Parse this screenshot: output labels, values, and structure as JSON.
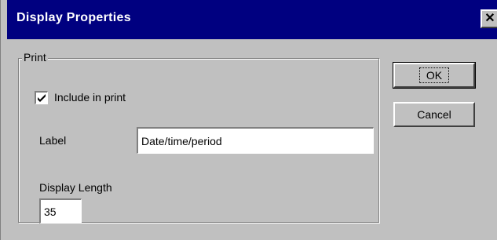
{
  "window": {
    "title": "Display Properties",
    "close_glyph": "✕"
  },
  "print_group": {
    "label": "Print",
    "include_in_print": {
      "label": "Include in print",
      "checked": true
    },
    "label_field": {
      "caption": "Label",
      "value": "Date/time/period"
    },
    "display_length": {
      "caption": "Display Length",
      "value": "35"
    }
  },
  "buttons": {
    "ok_label": "OK",
    "cancel_label": "Cancel"
  },
  "colors": {
    "titlebar": "#000080",
    "face": "#c0c0c0"
  }
}
